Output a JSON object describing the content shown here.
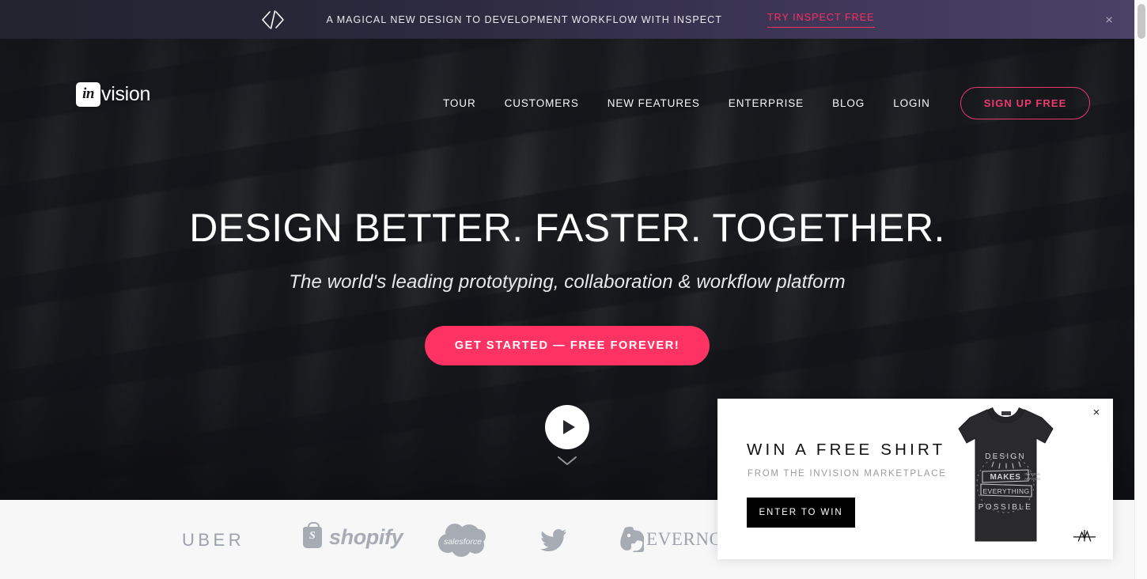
{
  "promo_banner": {
    "icon": "code-brackets-icon",
    "text": "A MAGICAL NEW DESIGN TO DEVELOPMENT WORKFLOW WITH INSPECT",
    "cta_label": "TRY INSPECT FREE",
    "close_label": "×",
    "accent_color": "#ff2d64",
    "gradient_from": "#23242f",
    "gradient_to": "#4a4266"
  },
  "nav": {
    "logo": {
      "mark_text": "in",
      "word_text": "vision"
    },
    "links": [
      {
        "label": "TOUR"
      },
      {
        "label": "CUSTOMERS"
      },
      {
        "label": "NEW FEATURES"
      },
      {
        "label": "ENTERPRISE"
      },
      {
        "label": "BLOG"
      },
      {
        "label": "LOGIN"
      }
    ],
    "signup_label": "SIGN UP FREE",
    "signup_color": "#ef3a6e"
  },
  "hero": {
    "headline": "DESIGN BETTER. FASTER. TOGETHER.",
    "subheadline": "The world's leading prototyping, collaboration & workflow platform",
    "cta_label": "GET STARTED — FREE FOREVER!",
    "cta_color": "#ff3363",
    "play_icon": "play-icon",
    "scroll_icon": "chevron-down-icon"
  },
  "client_logos": [
    {
      "name": "uber",
      "label": "UBER"
    },
    {
      "name": "shopify",
      "label": "shopify"
    },
    {
      "name": "salesforce",
      "label": "salesforce"
    },
    {
      "name": "twitter",
      "label": ""
    },
    {
      "name": "evernote",
      "label": "EVERNOTE"
    }
  ],
  "marketplace_popup": {
    "close_label": "×",
    "title": "WIN A FREE SHIRT",
    "subtitle": "FROM THE INVISION MARKETPLACE",
    "button_label": "ENTER TO WIN",
    "shirt_art_lines": [
      "DESIGN",
      "MAKES",
      "EVERYTHING",
      "POSSIBLE"
    ],
    "signature_icon": "signature-mark-icon",
    "button_color": "#000000"
  },
  "scrollbar": {
    "thumb_color": "#c6c6c6"
  }
}
